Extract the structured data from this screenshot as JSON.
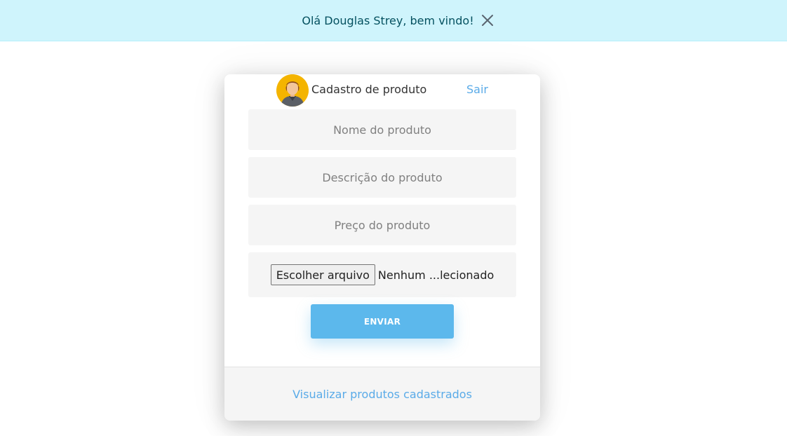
{
  "banner": {
    "message": "Olá Douglas Strey, bem vindo!",
    "close_icon": "close-icon",
    "background": "#cff4fc",
    "text_color": "#055160"
  },
  "form": {
    "title": "Cadastro de produto",
    "logout_label": "Sair",
    "avatar_icon": "user-avatar",
    "fields": {
      "name_placeholder": "Nome do produto",
      "description_placeholder": "Descrição do produto",
      "price_placeholder": "Preço do produto"
    },
    "file": {
      "button_label": "Escolher arquivo",
      "status": "Nenhum ...lecionado"
    },
    "submit_label": "ENVIAR",
    "footer_link": "Visualizar produtos cadastrados"
  },
  "colors": {
    "accent": "#5cb8ec",
    "link": "#5aabe8",
    "field_bg": "#f5f5f5"
  }
}
